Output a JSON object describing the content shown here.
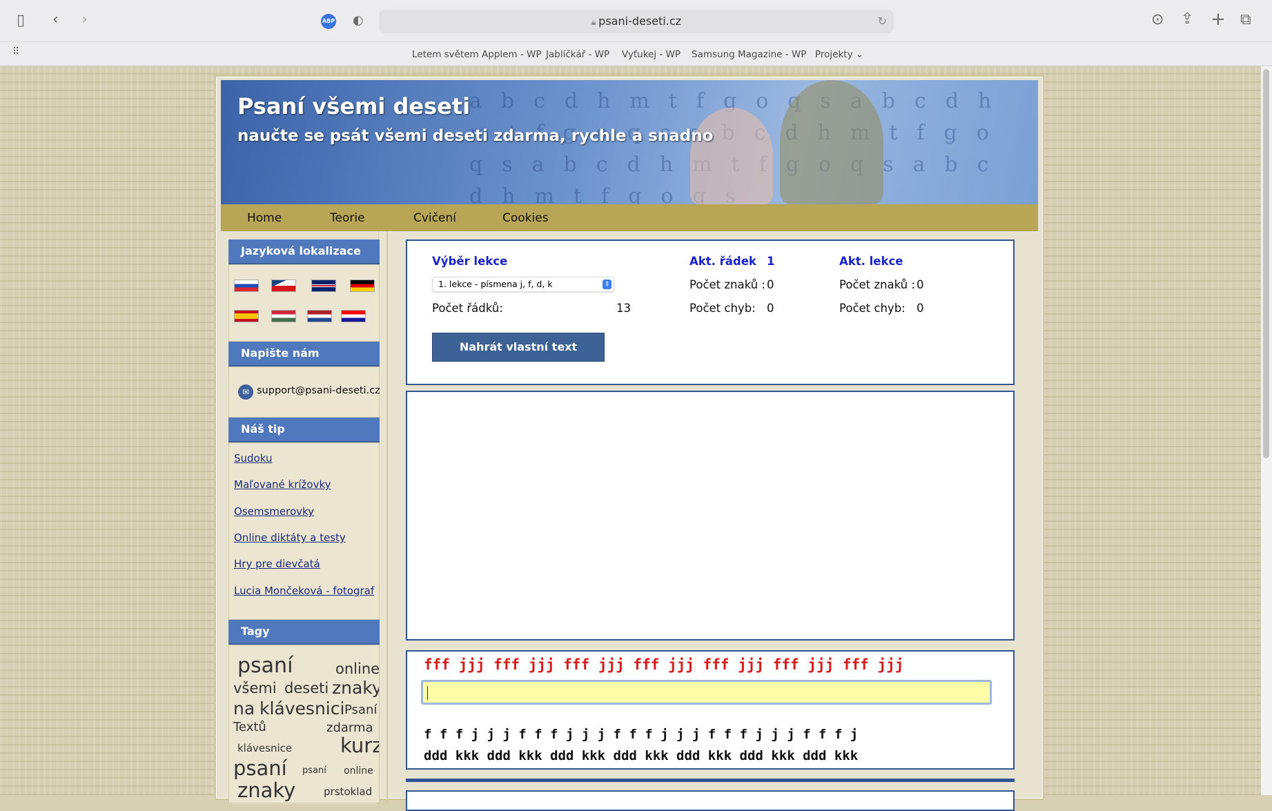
{
  "browser": {
    "url": "psani-deseti.cz",
    "adblock_label": "ABP",
    "bookmarks": [
      "Letem světem Applem - WP",
      "Jablíčkář - WP",
      "Vyťukej - WP",
      "Samsung Magazine - WP",
      "Projekty"
    ]
  },
  "header": {
    "title": "Psaní všemi deseti",
    "subtitle": "naučte se psát všemi deseti zdarma, rychle a snadno"
  },
  "nav": [
    "Home",
    "Teorie",
    "Cvičení",
    "Cookies"
  ],
  "sidebar": {
    "lang_heading": "Jazyková lokalizace",
    "contact_heading": "Napište nám",
    "email": "support@psani-deseti.cz",
    "tip_heading": "Náš tip",
    "links": [
      "Sudoku",
      "Maľované krížovky",
      "Osemsmerovky",
      "Online diktáty a testy",
      "Hry pre dievčatá",
      "Lucia Mončeková - fotograf"
    ],
    "tags_heading": "Tagy",
    "tags": [
      "psaní",
      "online",
      "všemi",
      "deseti",
      "znaky",
      "na",
      "klávesnici",
      "Psaní",
      "Textů",
      "zdarma",
      "klávesnice",
      "kurz",
      "psaní",
      "psaní",
      "online",
      "znaky",
      "prstoklad"
    ]
  },
  "lesson": {
    "select_label": "Výběr lekce",
    "selected": "1. lekce - písmena j, f, d, k",
    "rows_label": "Počet řádků:",
    "rows_value": "13",
    "upload_button": "Nahrát vlastní text",
    "row_heading": "Akt. řádek",
    "row_number": "1",
    "chars_label": "Počet znaků :",
    "row_chars": "0",
    "errors_label": "Počet chyb:",
    "row_errors": "0",
    "lesson_heading": "Akt. lekce",
    "lesson_chars": "0",
    "lesson_errors": "0"
  },
  "exercise": {
    "current_line": "fff jjj fff jjj fff jjj fff jjj fff jjj fff jjj fff jjj",
    "input_value": "",
    "next_lines": [
      "f f f j j j f f f j j j f f f j j j f f f j j j f f f j",
      "ddd kkk ddd kkk ddd kkk ddd kkk ddd kkk ddd kkk ddd kkk"
    ]
  }
}
